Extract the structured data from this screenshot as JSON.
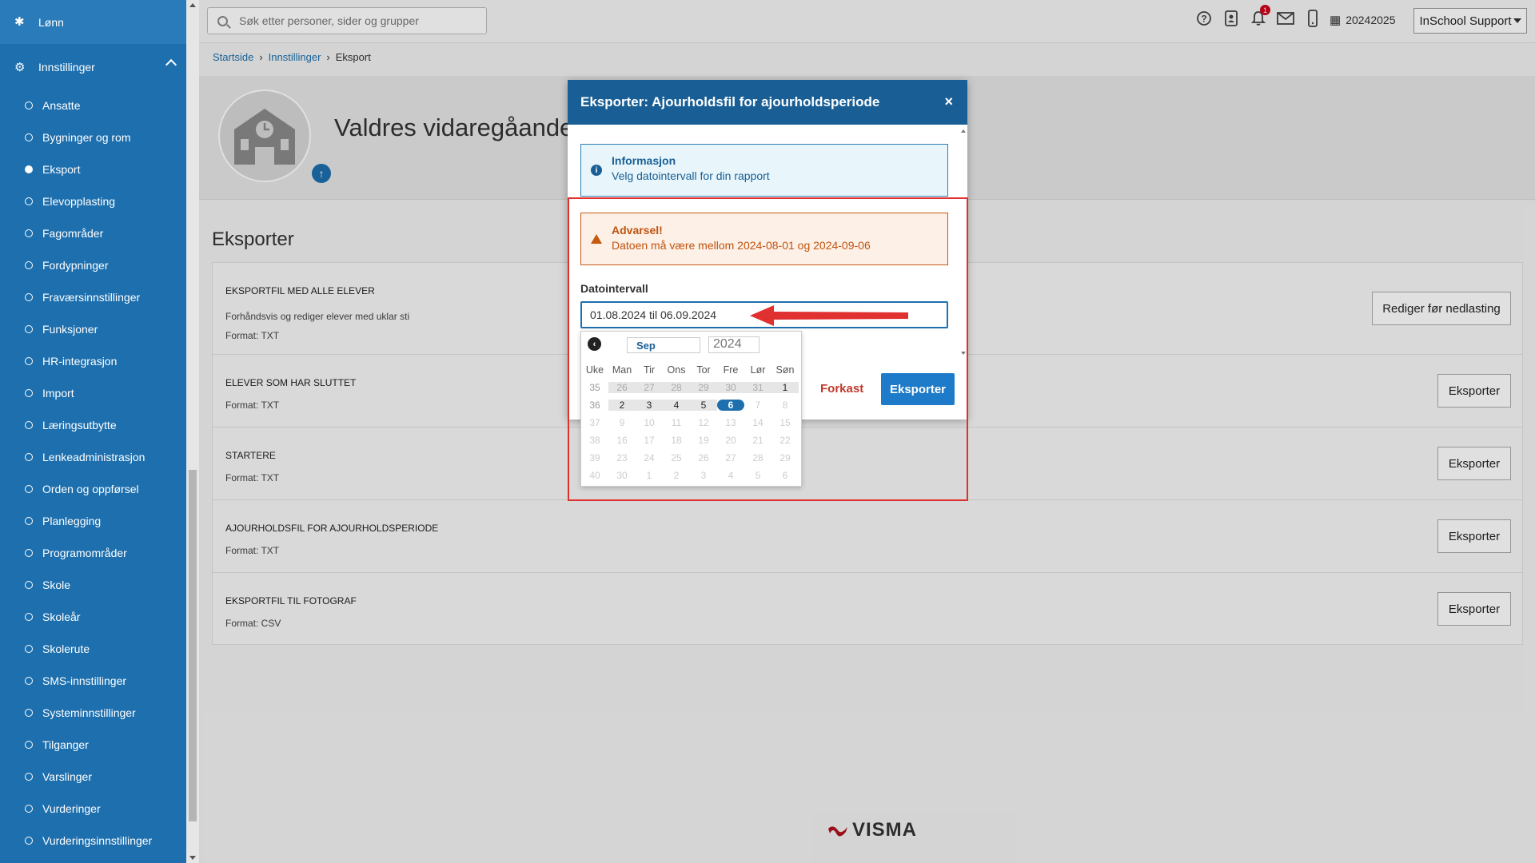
{
  "sidebar": {
    "top_item": "Lønn",
    "section": "Innstillinger",
    "items": [
      {
        "label": "Ansatte",
        "active": false
      },
      {
        "label": "Bygninger og rom",
        "active": false
      },
      {
        "label": "Eksport",
        "active": true
      },
      {
        "label": "Elevopplasting",
        "active": false
      },
      {
        "label": "Fagområder",
        "active": false
      },
      {
        "label": "Fordypninger",
        "active": false
      },
      {
        "label": "Fraværsinnstillinger",
        "active": false
      },
      {
        "label": "Funksjoner",
        "active": false
      },
      {
        "label": "HR-integrasjon",
        "active": false
      },
      {
        "label": "Import",
        "active": false
      },
      {
        "label": "Læringsutbytte",
        "active": false
      },
      {
        "label": "Lenkeadministrasjon",
        "active": false
      },
      {
        "label": "Orden og oppførsel",
        "active": false
      },
      {
        "label": "Planlegging",
        "active": false
      },
      {
        "label": "Programområder",
        "active": false
      },
      {
        "label": "Skole",
        "active": false
      },
      {
        "label": "Skoleår",
        "active": false
      },
      {
        "label": "Skolerute",
        "active": false
      },
      {
        "label": "SMS-innstillinger",
        "active": false
      },
      {
        "label": "Systeminnstillinger",
        "active": false
      },
      {
        "label": "Tilganger",
        "active": false
      },
      {
        "label": "Varslinger",
        "active": false
      },
      {
        "label": "Vurderinger",
        "active": false
      },
      {
        "label": "Vurderingsinnstillinger",
        "active": false
      }
    ]
  },
  "topbar": {
    "search_placeholder": "Søk etter personer, sider og grupper",
    "notification_count": "1",
    "period": "20242025",
    "user": "InSchool Support"
  },
  "breadcrumb": [
    "Startside",
    "Innstillinger",
    "Eksport"
  ],
  "school_name": "Valdres vidaregåande",
  "page_title": "Eksporter",
  "exports": [
    {
      "name": "EKSPORTFIL MED ALLE ELEVER",
      "desc": "Forhåndsvis og rediger elever med uklar sti",
      "format": "Format: TXT",
      "button": "Rediger før nedlasting"
    },
    {
      "name": "ELEVER SOM HAR SLUTTET",
      "desc": "",
      "format": "Format: TXT",
      "button": "Eksporter"
    },
    {
      "name": "STARTERE",
      "desc": "",
      "format": "Format: TXT",
      "button": "Eksporter"
    },
    {
      "name": "AJOURHOLDSFIL FOR AJOURHOLDSPERIODE",
      "desc": "",
      "format": "Format: TXT",
      "button": "Eksporter"
    },
    {
      "name": "EKSPORTFIL TIL FOTOGRAF",
      "desc": "",
      "format": "Format: CSV",
      "button": "Eksporter"
    }
  ],
  "footer_brand": "VISMA",
  "modal": {
    "title": "Eksporter: Ajourholdsfil for ajourholdsperiode",
    "close": "×",
    "info_title": "Informasjon",
    "info_text": "Velg datointervall for din rapport",
    "warn_title": "Advarsel!",
    "warn_text": "Datoen må være mellom 2024-08-01 og 2024-09-06",
    "field_label": "Datointervall",
    "date_value": "01.08.2024 til 06.09.2024",
    "cancel": "Forkast",
    "submit": "Eksporter"
  },
  "calendar": {
    "month": "Sep",
    "year": "2024",
    "headers": [
      "Uke",
      "Man",
      "Tir",
      "Ons",
      "Tor",
      "Fre",
      "Lør",
      "Søn"
    ],
    "weeks": [
      {
        "wk": "35",
        "days": [
          "26",
          "27",
          "28",
          "29",
          "30",
          "31",
          "1"
        ]
      },
      {
        "wk": "36",
        "days": [
          "2",
          "3",
          "4",
          "5",
          "6",
          "7",
          "8"
        ]
      },
      {
        "wk": "37",
        "days": [
          "9",
          "10",
          "11",
          "12",
          "13",
          "14",
          "15"
        ]
      },
      {
        "wk": "38",
        "days": [
          "16",
          "17",
          "18",
          "19",
          "20",
          "21",
          "22"
        ]
      },
      {
        "wk": "39",
        "days": [
          "23",
          "24",
          "25",
          "26",
          "27",
          "28",
          "29"
        ]
      },
      {
        "wk": "40",
        "days": [
          "30",
          "1",
          "2",
          "3",
          "4",
          "5",
          "6"
        ]
      }
    ]
  },
  "colors": {
    "sidebar": "#1d6fae",
    "modal_header": "#195f95",
    "primary_button": "#1d7bc9",
    "warning": "#c55a11",
    "highlight": "#e0302f"
  }
}
